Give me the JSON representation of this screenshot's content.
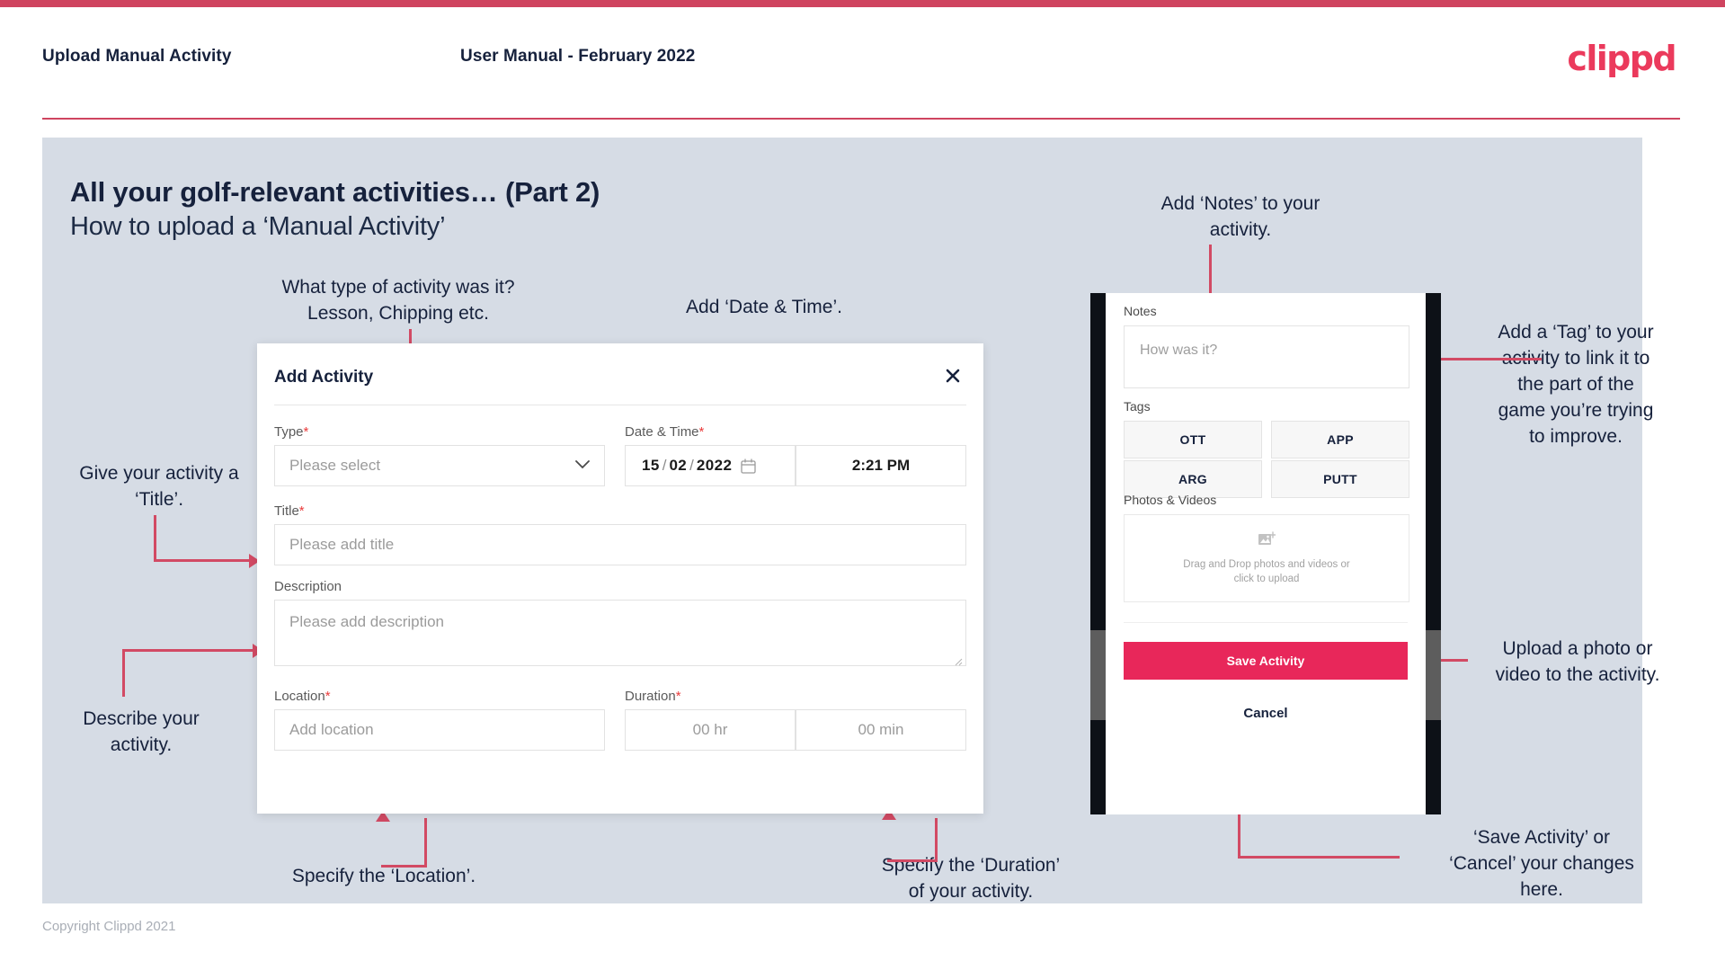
{
  "header": {
    "title": "Upload Manual Activity",
    "subtitle": "User Manual - February 2022",
    "logo": "clippd"
  },
  "slide": {
    "title_main": "All your golf-relevant activities… (Part 2)",
    "title_sub": "How to upload a ‘Manual Activity’"
  },
  "annotations": {
    "type": "What type of activity was it?\nLesson, Chipping etc.",
    "datetime": "Add ‘Date & Time’.",
    "title": "Give your activity a\n‘Title’.",
    "description": "Describe your\nactivity.",
    "location": "Specify the ‘Location’.",
    "duration": "Specify the ‘Duration’\nof your activity.",
    "notes": "Add ‘Notes’ to your\nactivity.",
    "tags": "Add a ‘Tag’ to your\nactivity to link it to\nthe part of the\ngame you’re trying\nto improve.",
    "photos": "Upload a photo or\nvideo to the activity.",
    "save": "‘Save Activity’ or\n‘Cancel’ your changes\nhere."
  },
  "dialog": {
    "title": "Add Activity",
    "close_icon": "close-icon",
    "fields": {
      "type": {
        "label": "Type",
        "required": "*",
        "placeholder": "Please select",
        "chevron_icon": "chevron-down-icon"
      },
      "datetime": {
        "label": "Date & Time",
        "required": "*",
        "day": "15",
        "month": "02",
        "year": "2022",
        "sep1": "/",
        "sep2": "/",
        "calendar_icon": "calendar-icon",
        "time": "2:21 PM"
      },
      "title": {
        "label": "Title",
        "required": "*",
        "placeholder": "Please add title"
      },
      "description": {
        "label": "Description",
        "placeholder": "Please add description"
      },
      "location": {
        "label": "Location",
        "required": "*",
        "placeholder": "Add location"
      },
      "duration": {
        "label": "Duration",
        "required": "*",
        "hours": "00 hr",
        "minutes": "00 min"
      }
    }
  },
  "phone": {
    "notes": {
      "label": "Notes",
      "placeholder": "How was it?"
    },
    "tags": {
      "label": "Tags",
      "items": [
        "OTT",
        "APP",
        "ARG",
        "PUTT"
      ]
    },
    "photos": {
      "label": "Photos & Videos",
      "icon": "add-image-icon",
      "line1": "Drag and Drop photos and videos or",
      "line2": "click to upload"
    },
    "save_label": "Save Activity",
    "cancel_label": "Cancel"
  },
  "footer": {
    "copyright": "Copyright Clippd 2021"
  },
  "colors": {
    "accent": "#e8275a",
    "brand": "#eb3a5c",
    "connector": "#d24a64",
    "panel": "#d6dce5",
    "text": "#16213c"
  }
}
